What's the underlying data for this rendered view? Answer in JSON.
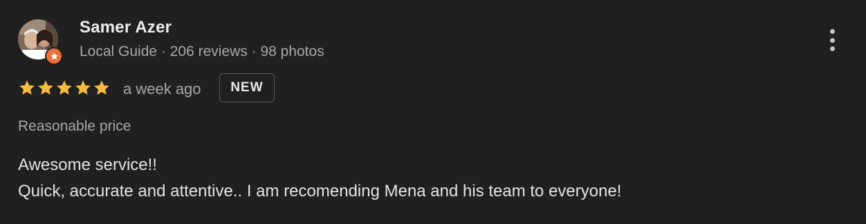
{
  "reviewer": {
    "name": "Samer Azer",
    "meta": "Local Guide · 206 reviews · 98 photos"
  },
  "rating": {
    "stars": 5,
    "max": 5,
    "time": "a week ago",
    "badge": "NEW"
  },
  "tag": "Reasonable price",
  "review": {
    "line1": "Awesome service!!",
    "line2": "Quick, accurate and attentive.. I am recomending Mena and his team to everyone!"
  },
  "colors": {
    "background": "#202020",
    "star": "#f6bb42",
    "guide_badge": "#e8713c"
  },
  "icons": {
    "more": "more-vert-icon",
    "badge": "local-guide-star-icon"
  }
}
